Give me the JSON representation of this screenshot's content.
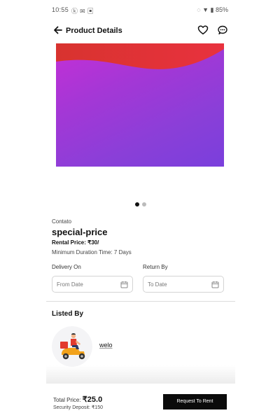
{
  "status_bar": {
    "time": "10:55",
    "left_icons": "ⓚ ✉ ▣",
    "right_icons": "◌ ▼ ▮ 85%"
  },
  "header": {
    "title": "Product Details",
    "icons": [
      "back-arrow-icon",
      "heart-icon",
      "chat-icon"
    ]
  },
  "gallery": {
    "slide_count": 2,
    "active_slide": 1,
    "colors": {
      "wave": "#e0303a",
      "purple_top": "#c52fd6",
      "purple_bottom": "#7a3fdc"
    }
  },
  "product": {
    "category": "Contato",
    "name": "special-price",
    "rental_price": "Rental Price: ₹30/",
    "min_duration": "Minimum Duration Time: 7 Days"
  },
  "dates": {
    "delivery_label": "Delivery On",
    "return_label": "Return By",
    "from_placeholder": "From Date",
    "to_placeholder": "To Date"
  },
  "listed_by": {
    "heading": "Listed By",
    "owner_name": "welo"
  },
  "footer": {
    "total_label": "Total Price: ",
    "total_value": "₹25.0",
    "deposit": "Security Deposit: ₹150",
    "request_button": "Request To Rent"
  }
}
